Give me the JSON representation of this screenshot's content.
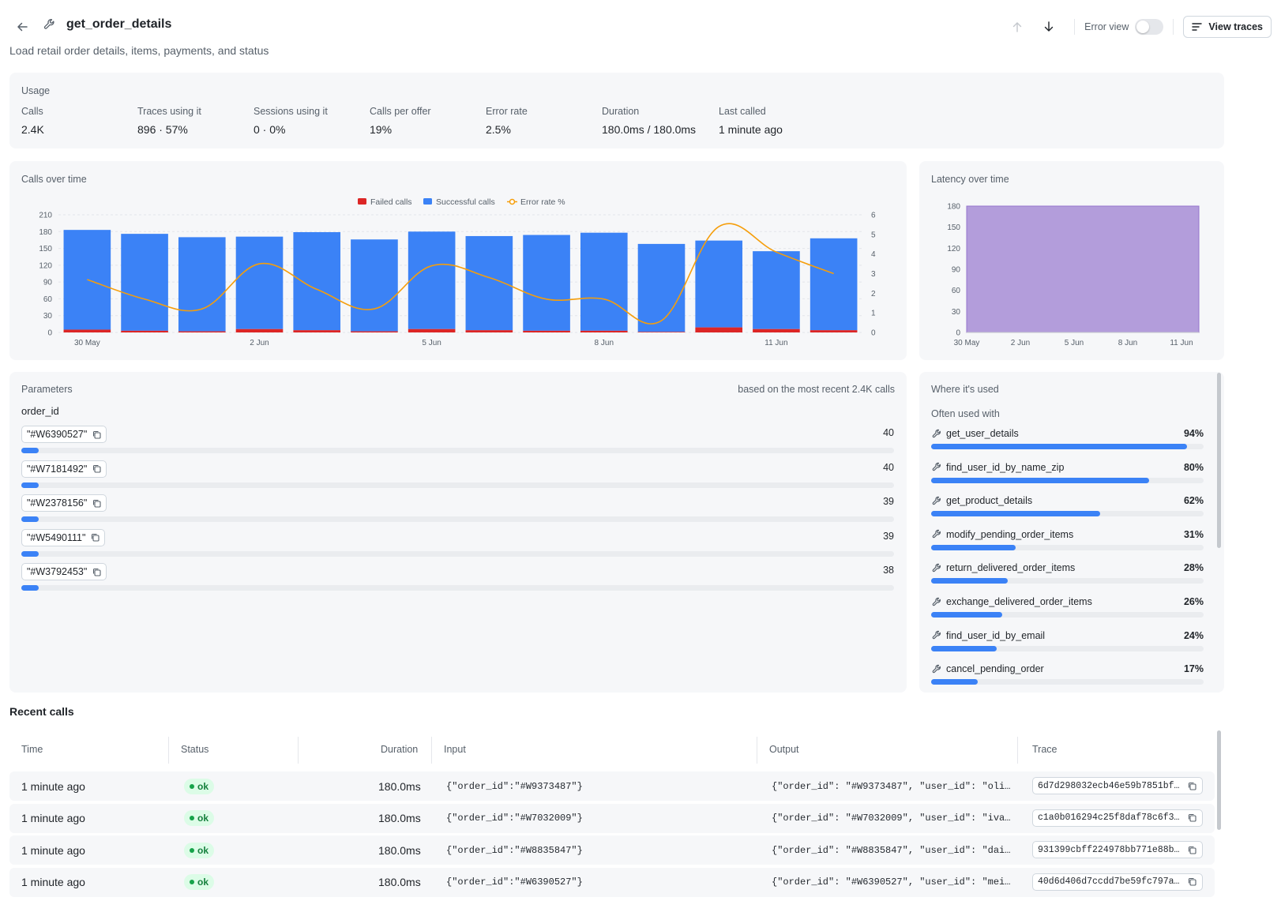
{
  "header": {
    "title": "get_order_details",
    "subtitle": "Load retail order details, items, payments, and status",
    "error_view_label": "Error view",
    "error_view_on": false,
    "view_traces_label": "View traces"
  },
  "usage": {
    "title": "Usage",
    "metrics": [
      {
        "label": "Calls",
        "value": "2.4K"
      },
      {
        "label": "Traces using it",
        "value": "896 · 57%"
      },
      {
        "label": "Sessions using it",
        "value": "0 · 0%"
      },
      {
        "label": "Calls per offer",
        "value": "19%"
      },
      {
        "label": "Error rate",
        "value": "2.5%"
      },
      {
        "label": "Duration",
        "value": "180.0ms / 180.0ms"
      },
      {
        "label": "Last called",
        "value": "1 minute ago"
      }
    ]
  },
  "chart_data": [
    {
      "type": "bar",
      "title": "Calls over time",
      "stacked": true,
      "categories": [
        "30 May",
        "31 May",
        "1 Jun",
        "2 Jun",
        "3 Jun",
        "4 Jun",
        "5 Jun",
        "6 Jun",
        "7 Jun",
        "8 Jun",
        "9 Jun",
        "10 Jun",
        "11 Jun",
        "12 Jun"
      ],
      "x_tick_labels": [
        "30 May",
        "2 Jun",
        "5 Jun",
        "8 Jun",
        "11 Jun"
      ],
      "series": [
        {
          "name": "Failed calls",
          "values": [
            5,
            3,
            2,
            6,
            4,
            2,
            6,
            4,
            3,
            3,
            1,
            9,
            6,
            4
          ],
          "color": "#dc2626"
        },
        {
          "name": "Successful calls",
          "values": [
            178,
            173,
            168,
            165,
            175,
            164,
            174,
            168,
            171,
            175,
            157,
            155,
            139,
            164
          ],
          "color": "#3b82f6"
        },
        {
          "name": "Error rate %",
          "values": [
            2.7,
            1.7,
            1.2,
            3.5,
            2.2,
            1.2,
            3.4,
            2.8,
            1.7,
            1.7,
            0.6,
            5.4,
            4.1,
            3.0
          ],
          "color": "#f59e0b",
          "axis": "right",
          "line": true
        }
      ],
      "ylim": [
        0,
        210
      ],
      "yticks": [
        0,
        30,
        60,
        90,
        120,
        150,
        180,
        210
      ],
      "y2lim": [
        0,
        6
      ],
      "y2ticks": [
        0,
        1,
        2,
        3,
        4,
        5,
        6
      ],
      "grid": true,
      "legend": "top"
    },
    {
      "type": "area",
      "title": "Latency over time",
      "x_tick_labels": [
        "30 May",
        "2 Jun",
        "5 Jun",
        "8 Jun",
        "11 Jun"
      ],
      "series": [
        {
          "name": "Latency",
          "values": [
            180,
            180,
            180,
            180,
            180,
            180,
            180,
            180,
            180,
            180,
            180,
            180,
            180,
            180
          ],
          "color": "#b39ddb"
        }
      ],
      "ylim": [
        0,
        180
      ],
      "yticks": [
        0,
        30,
        60,
        90,
        120,
        150,
        180
      ],
      "grid": false
    }
  ],
  "parameters": {
    "title": "Parameters",
    "note": "based on the most recent 2.4K calls",
    "param_name": "order_id",
    "max_count": 2400,
    "values": [
      {
        "value": "\"#W6390527\"",
        "count": 40
      },
      {
        "value": "\"#W7181492\"",
        "count": 40
      },
      {
        "value": "\"#W2378156\"",
        "count": 39
      },
      {
        "value": "\"#W5490111\"",
        "count": 39
      },
      {
        "value": "\"#W3792453\"",
        "count": 38
      }
    ]
  },
  "where_used": {
    "title": "Where it's used",
    "often_label": "Often used with",
    "items": [
      {
        "name": "get_user_details",
        "pct_label": "94%",
        "pct": 0.94
      },
      {
        "name": "find_user_id_by_name_zip",
        "pct_label": "80%",
        "pct": 0.8
      },
      {
        "name": "get_product_details",
        "pct_label": "62%",
        "pct": 0.62
      },
      {
        "name": "modify_pending_order_items",
        "pct_label": "31%",
        "pct": 0.31
      },
      {
        "name": "return_delivered_order_items",
        "pct_label": "28%",
        "pct": 0.28
      },
      {
        "name": "exchange_delivered_order_items",
        "pct_label": "26%",
        "pct": 0.26
      },
      {
        "name": "find_user_id_by_email",
        "pct_label": "24%",
        "pct": 0.24
      },
      {
        "name": "cancel_pending_order",
        "pct_label": "17%",
        "pct": 0.17
      }
    ]
  },
  "recent_calls": {
    "title": "Recent calls",
    "columns": {
      "time": "Time",
      "status": "Status",
      "duration": "Duration",
      "input": "Input",
      "output": "Output",
      "trace": "Trace"
    },
    "rows": [
      {
        "time": "1 minute ago",
        "status": "ok",
        "duration": "180.0ms",
        "input": "{\"order_id\":\"#W9373487\"}",
        "output": "{\"order_id\": \"#W9373487\", \"user_id\": \"oli…",
        "trace": "6d7d298032ecb46e59b7851bf…"
      },
      {
        "time": "1 minute ago",
        "status": "ok",
        "duration": "180.0ms",
        "input": "{\"order_id\":\"#W7032009\"}",
        "output": "{\"order_id\": \"#W7032009\", \"user_id\": \"iva…",
        "trace": "c1a0b016294c25f8daf78c6f36…"
      },
      {
        "time": "1 minute ago",
        "status": "ok",
        "duration": "180.0ms",
        "input": "{\"order_id\":\"#W8835847\"}",
        "output": "{\"order_id\": \"#W8835847\", \"user_id\": \"dai…",
        "trace": "931399cbff224978bb771e88b9…"
      },
      {
        "time": "1 minute ago",
        "status": "ok",
        "duration": "180.0ms",
        "input": "{\"order_id\":\"#W6390527\"}",
        "output": "{\"order_id\": \"#W6390527\", \"user_id\": \"mei…",
        "trace": "40d6d406d7ccdd7be59fc797a4…"
      }
    ]
  }
}
